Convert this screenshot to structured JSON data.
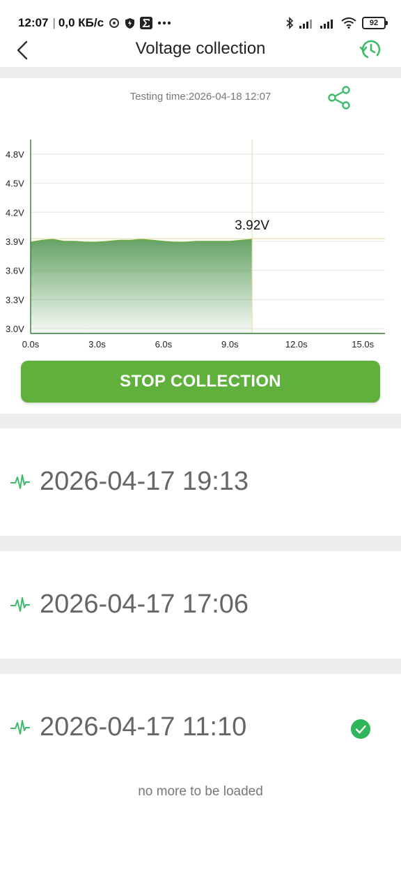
{
  "status_bar": {
    "time": "12:07",
    "speed": "0,0 КБ/с",
    "battery": "92"
  },
  "header": {
    "title": "Voltage collection"
  },
  "testing_time": "Testing time:2026-04-18 12:07",
  "chart_data": {
    "type": "area",
    "x_ticks": [
      "0.0s",
      "3.0s",
      "6.0s",
      "9.0s",
      "12.0s",
      "15.0s"
    ],
    "y_ticks": [
      "3.0V",
      "3.3V",
      "3.6V",
      "3.9V",
      "4.2V",
      "4.5V",
      "4.8V"
    ],
    "xlim": [
      0,
      16
    ],
    "ylim": [
      2.95,
      4.95
    ],
    "x": [
      0,
      0.5,
      1.0,
      1.5,
      2.0,
      2.5,
      3.0,
      3.5,
      4.0,
      4.5,
      5.0,
      5.5,
      6.0,
      6.5,
      7.0,
      7.5,
      8.0,
      8.5,
      9.0,
      9.5,
      10.0
    ],
    "values": [
      3.89,
      3.91,
      3.92,
      3.9,
      3.9,
      3.89,
      3.89,
      3.9,
      3.91,
      3.91,
      3.92,
      3.91,
      3.9,
      3.89,
      3.89,
      3.9,
      3.9,
      3.9,
      3.9,
      3.91,
      3.92
    ],
    "cursor_x": 10.0,
    "cursor_label": "3.92V",
    "colors": {
      "line": "#6aab45",
      "fill_top": "#5e9e5e",
      "cursor": "#e8d9a0",
      "axis": "#2e7d32"
    }
  },
  "actions": {
    "stop_label": "STOP COLLECTION"
  },
  "records": [
    {
      "time": "2026-04-17 19:13",
      "selected": false
    },
    {
      "time": "2026-04-17 17:06",
      "selected": false
    },
    {
      "time": "2026-04-17 11:10",
      "selected": true
    }
  ],
  "footer": "no more to be loaded",
  "colors": {
    "accent": "#5fb13c",
    "check": "#2fb65a",
    "icon_green": "#3dbb6a"
  }
}
